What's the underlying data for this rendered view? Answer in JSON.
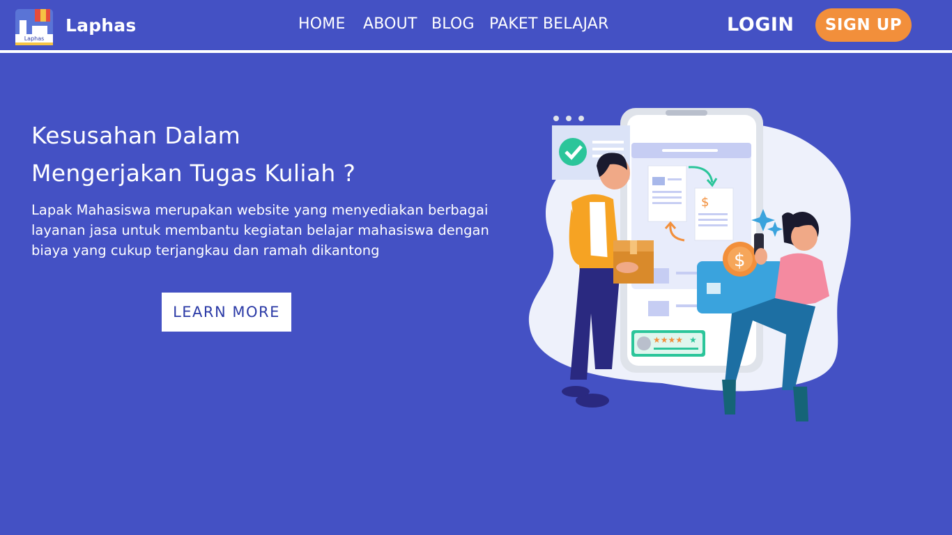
{
  "brand": {
    "name": "Laphas",
    "logo_text": "Laphas"
  },
  "nav": {
    "items": [
      {
        "label": "HOME"
      },
      {
        "label": "ABOUT"
      },
      {
        "label": "BLOG"
      },
      {
        "label": "PAKET BELAJAR"
      }
    ],
    "login_label": "LOGIN",
    "signup_label": "SIGN UP"
  },
  "hero": {
    "title_line1": "Kesusahan Dalam",
    "title_line2": "Mengerjakan Tugas Kuliah ?",
    "description": "Lapak Mahasiswa merupakan website yang menyediakan berbagai layanan jasa untuk membantu kegiatan belajar mahasiswa dengan biaya yang cukup terjangkau dan ramah dikantong",
    "cta_label": "LEARN MORE"
  },
  "illustration": {
    "icons": [
      "check-icon",
      "dollar-icon",
      "document-icon",
      "package-icon",
      "star-rating-icon",
      "phone-icon",
      "credit-card-icon"
    ]
  },
  "colors": {
    "background": "#4451c4",
    "accent": "#f28f3b",
    "text": "#ffffff",
    "cta_text": "#2b3aa6"
  }
}
